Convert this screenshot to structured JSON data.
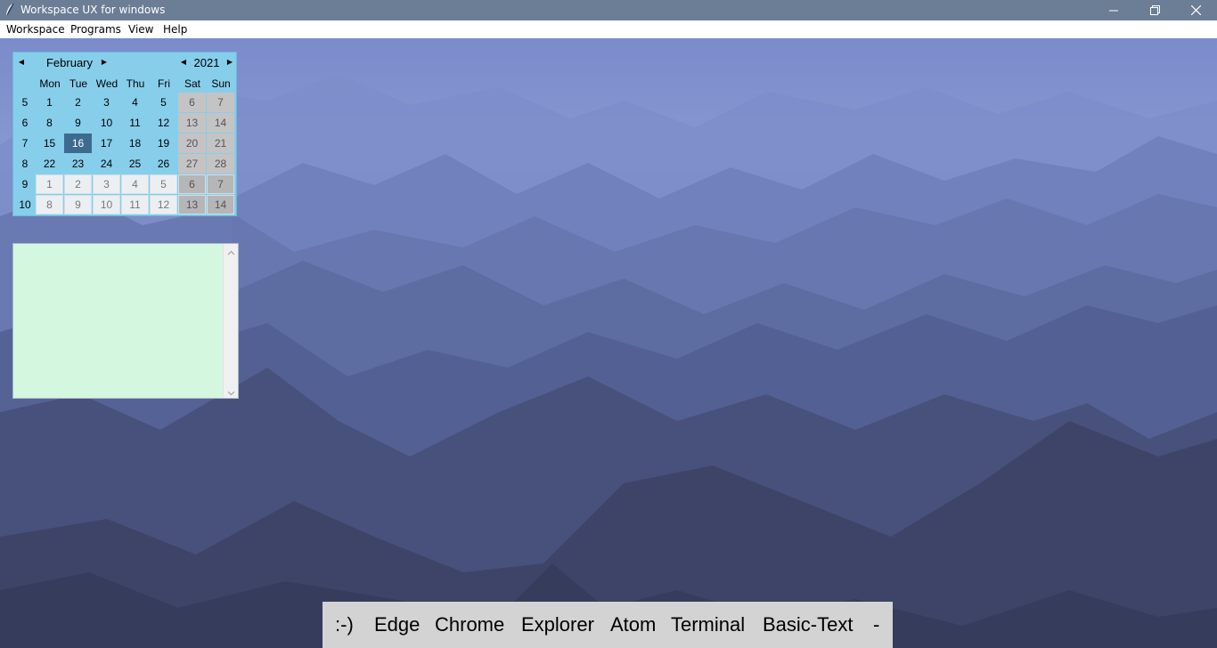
{
  "window": {
    "title": "Workspace UX for windows",
    "controls": {
      "minimize": "minimize-icon",
      "maximize": "restore-icon",
      "close": "close-icon"
    }
  },
  "menu": {
    "items": [
      "Workspace",
      "Programs",
      "View",
      "Help"
    ]
  },
  "calendar": {
    "month": "February",
    "year": "2021",
    "nav_icons": [
      "prev-month-icon",
      "next-month-icon",
      "prev-year-icon",
      "next-year-icon"
    ],
    "day_headers": [
      "Mon",
      "Tue",
      "Wed",
      "Thu",
      "Fri",
      "Sat",
      "Sun"
    ],
    "weeks": [
      {
        "wk": "5",
        "days": [
          "1",
          "2",
          "3",
          "4",
          "5",
          "6",
          "7"
        ]
      },
      {
        "wk": "6",
        "days": [
          "8",
          "9",
          "10",
          "11",
          "12",
          "13",
          "14"
        ]
      },
      {
        "wk": "7",
        "days": [
          "15",
          "16",
          "17",
          "18",
          "19",
          "20",
          "21"
        ]
      },
      {
        "wk": "8",
        "days": [
          "22",
          "23",
          "24",
          "25",
          "26",
          "27",
          "28"
        ]
      },
      {
        "wk": "9",
        "days": [
          "1",
          "2",
          "3",
          "4",
          "5",
          "6",
          "7"
        ]
      },
      {
        "wk": "10",
        "days": [
          "8",
          "9",
          "10",
          "11",
          "12",
          "13",
          "14"
        ]
      }
    ],
    "selected_day": "16",
    "colors": {
      "background": "#87ceeb",
      "selected": "#3e6a8f",
      "weekend": "#c4c4c4"
    }
  },
  "notes": {
    "value": "",
    "background": "#d4f7e0"
  },
  "taskbar": {
    "items": [
      ":-)",
      "Edge",
      "Chrome",
      "Explorer",
      "Atom",
      "Terminal",
      "Basic-Text",
      "-"
    ]
  }
}
